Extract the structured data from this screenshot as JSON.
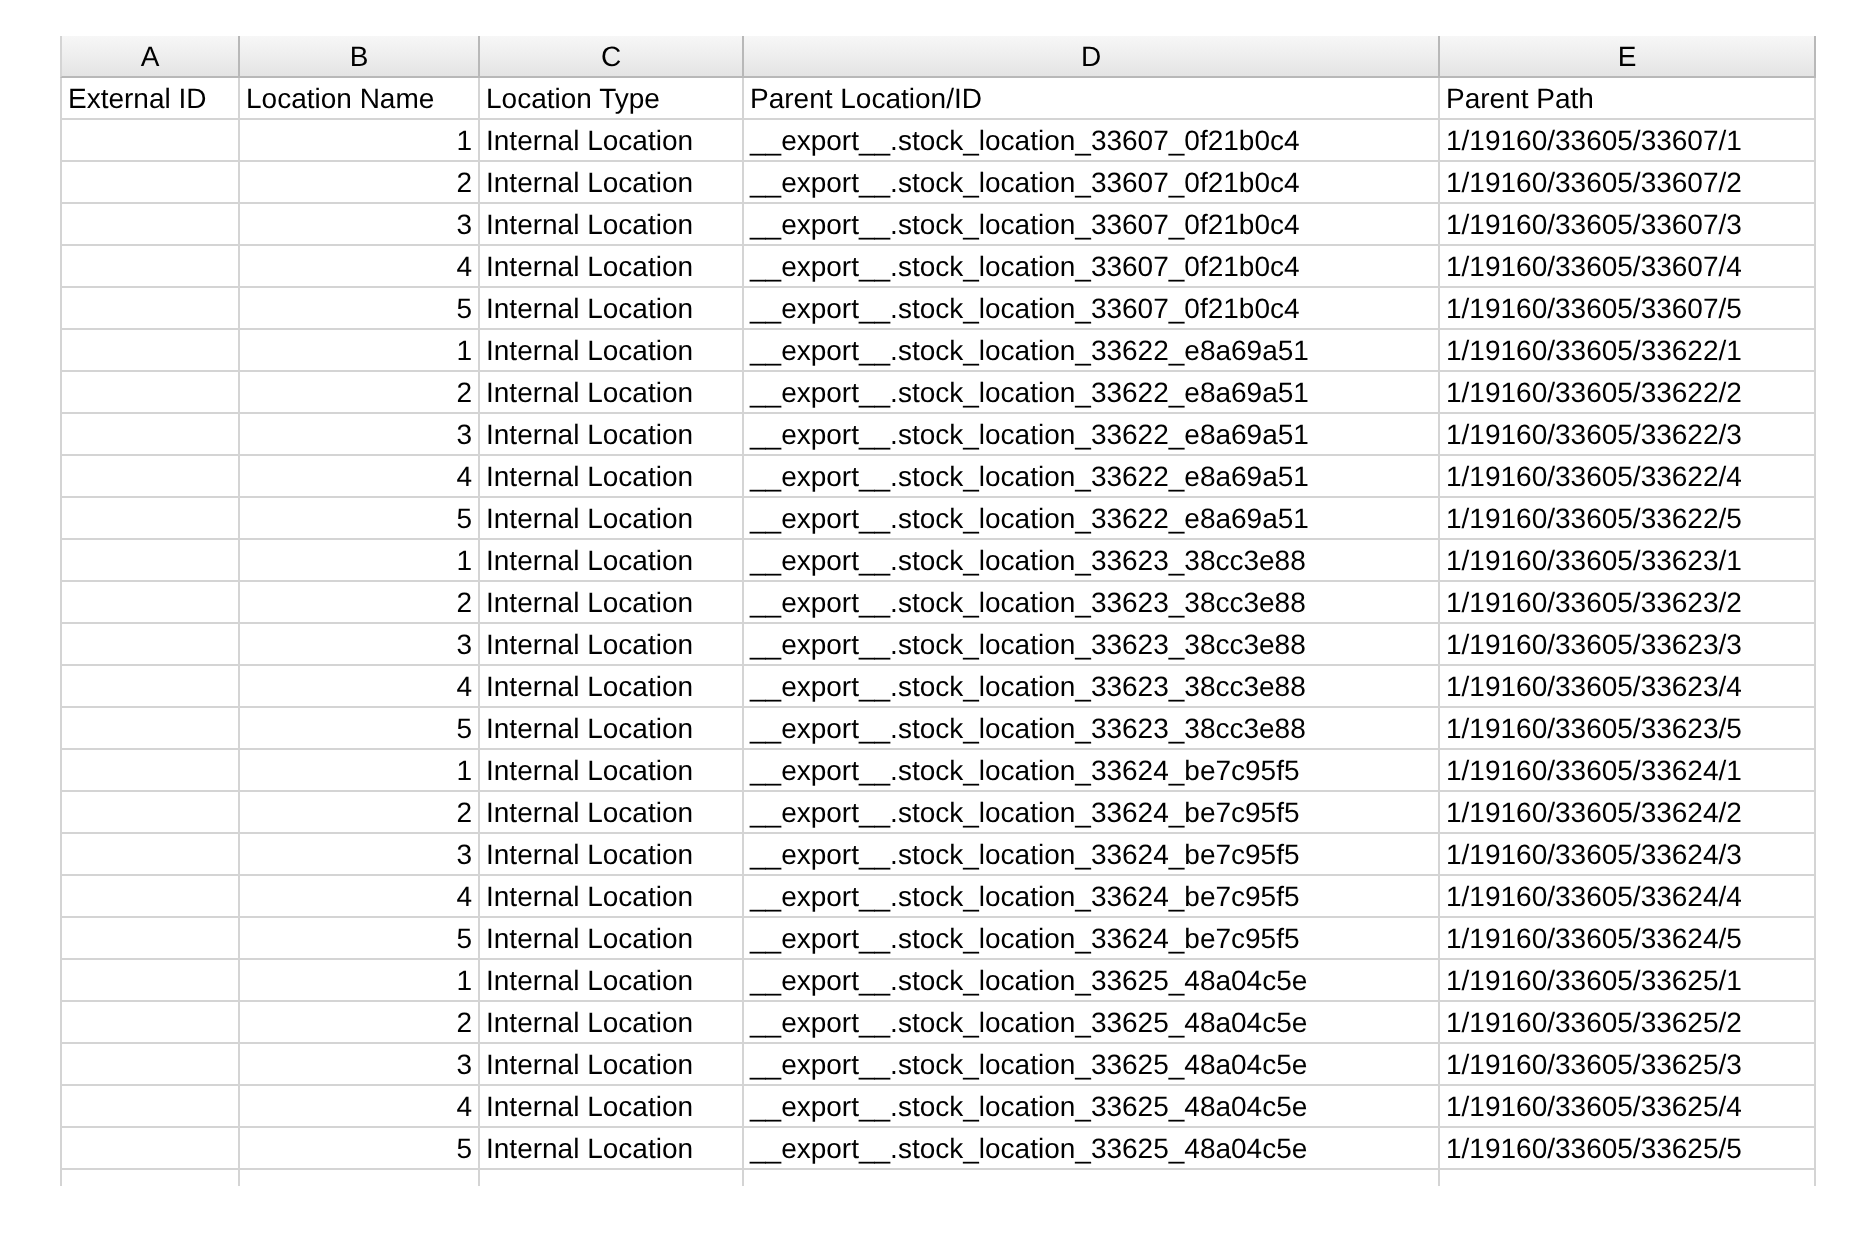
{
  "column_letters": [
    "A",
    "B",
    "C",
    "D",
    "E"
  ],
  "header_row": [
    "External ID",
    "Location Name",
    "Location Type",
    "Parent Location/ID",
    "Parent Path"
  ],
  "rows": [
    {
      "location_name": "1",
      "location_type": "Internal Location",
      "parent_location": "__export__.stock_location_33607_0f21b0c4",
      "parent_path": "1/19160/33605/33607/1"
    },
    {
      "location_name": "2",
      "location_type": "Internal Location",
      "parent_location": "__export__.stock_location_33607_0f21b0c4",
      "parent_path": "1/19160/33605/33607/2"
    },
    {
      "location_name": "3",
      "location_type": "Internal Location",
      "parent_location": "__export__.stock_location_33607_0f21b0c4",
      "parent_path": "1/19160/33605/33607/3"
    },
    {
      "location_name": "4",
      "location_type": "Internal Location",
      "parent_location": "__export__.stock_location_33607_0f21b0c4",
      "parent_path": "1/19160/33605/33607/4"
    },
    {
      "location_name": "5",
      "location_type": "Internal Location",
      "parent_location": "__export__.stock_location_33607_0f21b0c4",
      "parent_path": "1/19160/33605/33607/5"
    },
    {
      "location_name": "1",
      "location_type": "Internal Location",
      "parent_location": "__export__.stock_location_33622_e8a69a51",
      "parent_path": "1/19160/33605/33622/1"
    },
    {
      "location_name": "2",
      "location_type": "Internal Location",
      "parent_location": "__export__.stock_location_33622_e8a69a51",
      "parent_path": "1/19160/33605/33622/2"
    },
    {
      "location_name": "3",
      "location_type": "Internal Location",
      "parent_location": "__export__.stock_location_33622_e8a69a51",
      "parent_path": "1/19160/33605/33622/3"
    },
    {
      "location_name": "4",
      "location_type": "Internal Location",
      "parent_location": "__export__.stock_location_33622_e8a69a51",
      "parent_path": "1/19160/33605/33622/4"
    },
    {
      "location_name": "5",
      "location_type": "Internal Location",
      "parent_location": "__export__.stock_location_33622_e8a69a51",
      "parent_path": "1/19160/33605/33622/5"
    },
    {
      "location_name": "1",
      "location_type": "Internal Location",
      "parent_location": "__export__.stock_location_33623_38cc3e88",
      "parent_path": "1/19160/33605/33623/1"
    },
    {
      "location_name": "2",
      "location_type": "Internal Location",
      "parent_location": "__export__.stock_location_33623_38cc3e88",
      "parent_path": "1/19160/33605/33623/2"
    },
    {
      "location_name": "3",
      "location_type": "Internal Location",
      "parent_location": "__export__.stock_location_33623_38cc3e88",
      "parent_path": "1/19160/33605/33623/3"
    },
    {
      "location_name": "4",
      "location_type": "Internal Location",
      "parent_location": "__export__.stock_location_33623_38cc3e88",
      "parent_path": "1/19160/33605/33623/4"
    },
    {
      "location_name": "5",
      "location_type": "Internal Location",
      "parent_location": "__export__.stock_location_33623_38cc3e88",
      "parent_path": "1/19160/33605/33623/5"
    },
    {
      "location_name": "1",
      "location_type": "Internal Location",
      "parent_location": "__export__.stock_location_33624_be7c95f5",
      "parent_path": "1/19160/33605/33624/1"
    },
    {
      "location_name": "2",
      "location_type": "Internal Location",
      "parent_location": "__export__.stock_location_33624_be7c95f5",
      "parent_path": "1/19160/33605/33624/2"
    },
    {
      "location_name": "3",
      "location_type": "Internal Location",
      "parent_location": "__export__.stock_location_33624_be7c95f5",
      "parent_path": "1/19160/33605/33624/3"
    },
    {
      "location_name": "4",
      "location_type": "Internal Location",
      "parent_location": "__export__.stock_location_33624_be7c95f5",
      "parent_path": "1/19160/33605/33624/4"
    },
    {
      "location_name": "5",
      "location_type": "Internal Location",
      "parent_location": "__export__.stock_location_33624_be7c95f5",
      "parent_path": "1/19160/33605/33624/5"
    },
    {
      "location_name": "1",
      "location_type": "Internal Location",
      "parent_location": "__export__.stock_location_33625_48a04c5e",
      "parent_path": "1/19160/33605/33625/1"
    },
    {
      "location_name": "2",
      "location_type": "Internal Location",
      "parent_location": "__export__.stock_location_33625_48a04c5e",
      "parent_path": "1/19160/33605/33625/2"
    },
    {
      "location_name": "3",
      "location_type": "Internal Location",
      "parent_location": "__export__.stock_location_33625_48a04c5e",
      "parent_path": "1/19160/33605/33625/3"
    },
    {
      "location_name": "4",
      "location_type": "Internal Location",
      "parent_location": "__export__.stock_location_33625_48a04c5e",
      "parent_path": "1/19160/33605/33625/4"
    },
    {
      "location_name": "5",
      "location_type": "Internal Location",
      "parent_location": "__export__.stock_location_33625_48a04c5e",
      "parent_path": "1/19160/33605/33625/5"
    }
  ]
}
